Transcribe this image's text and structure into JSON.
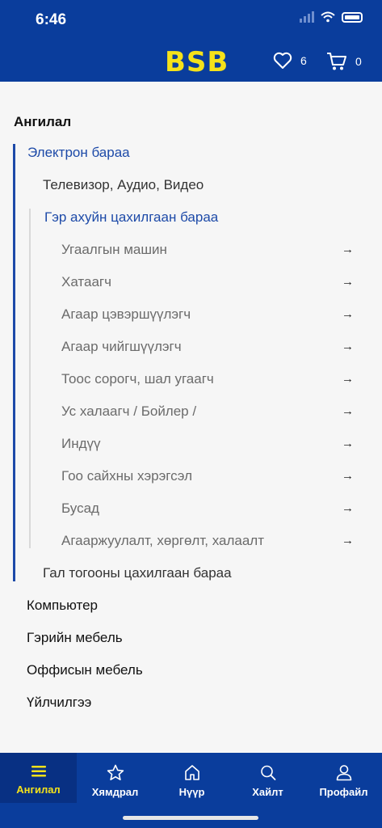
{
  "status": {
    "time": "6:46"
  },
  "header": {
    "logo": "BSB",
    "wishlist_count": "6",
    "cart_count": "0"
  },
  "section_title": "Ангилал",
  "categories": {
    "electronics": "Электрон бараа",
    "tv_audio": "Телевизор, Аудио, Видео",
    "home_appliances": "Гэр ахуйн цахилгаан бараа",
    "home_items": [
      "Угаалгын машин",
      "Хатаагч",
      "Агаар цэвэршүүлэгч",
      "Агаар чийгшүүлэгч",
      "Тоос сорогч, шал угаагч",
      "Ус халаагч / Бойлер /",
      "Индүү",
      "Гоо сайхны хэрэгсэл",
      "Бусад",
      "Агааржуулалт, хөргөлт, халаалт"
    ],
    "kitchen": "Гал тогооны цахилгаан бараа",
    "top_level": [
      "Компьютер",
      "Гэрийн мебель",
      "Оффисын мебель",
      "Үйлчилгээ"
    ]
  },
  "arrow_glyph": "→",
  "tabs": [
    "Ангилал",
    "Хямдрал",
    "Нүүр",
    "Хайлт",
    "Профайл"
  ],
  "colors": {
    "primary": "#0a3d9c",
    "accent": "#f5e21a",
    "link": "#1d4aa8"
  }
}
